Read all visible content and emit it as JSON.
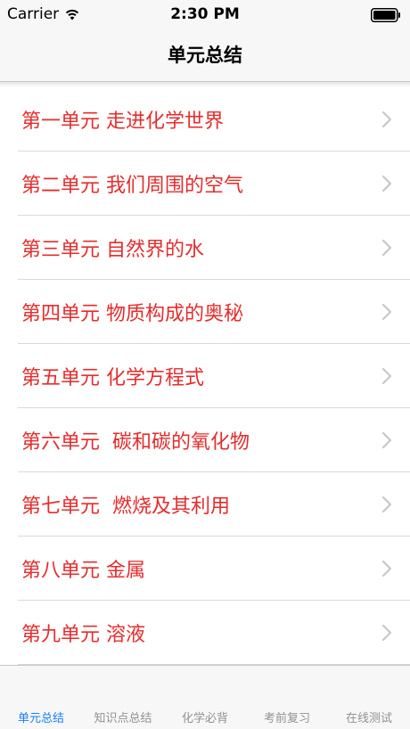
{
  "status_bar": {
    "carrier": "Carrier",
    "time": "2:30 PM",
    "wifi_icon": "wifi-icon",
    "battery_icon": "battery-icon"
  },
  "nav_bar": {
    "title": "单元总结"
  },
  "list": {
    "chevron_icon": "chevron-right-icon",
    "items": [
      {
        "label": "第一单元 走进化学世界"
      },
      {
        "label": "第二单元 我们周围的空气"
      },
      {
        "label": "第三单元 自然界的水"
      },
      {
        "label": "第四单元 物质构成的奥秘"
      },
      {
        "label": "第五单元 化学方程式"
      },
      {
        "label": "第六单元  碳和碳的氧化物"
      },
      {
        "label": "第七单元  燃烧及其利用"
      },
      {
        "label": "第八单元 金属"
      },
      {
        "label": "第九单元 溶液"
      }
    ]
  },
  "tab_bar": {
    "active_index": 0,
    "tabs": [
      {
        "label": "单元总结"
      },
      {
        "label": "知识点总结"
      },
      {
        "label": "化学必背"
      },
      {
        "label": "考前复习"
      },
      {
        "label": "在线测试"
      }
    ]
  },
  "colors": {
    "item_text": "#e62c2c",
    "tab_active": "#1a7ff5",
    "tab_inactive": "#929292",
    "chevron": "#c7c7cc",
    "bar_background": "#f7f7f7"
  }
}
